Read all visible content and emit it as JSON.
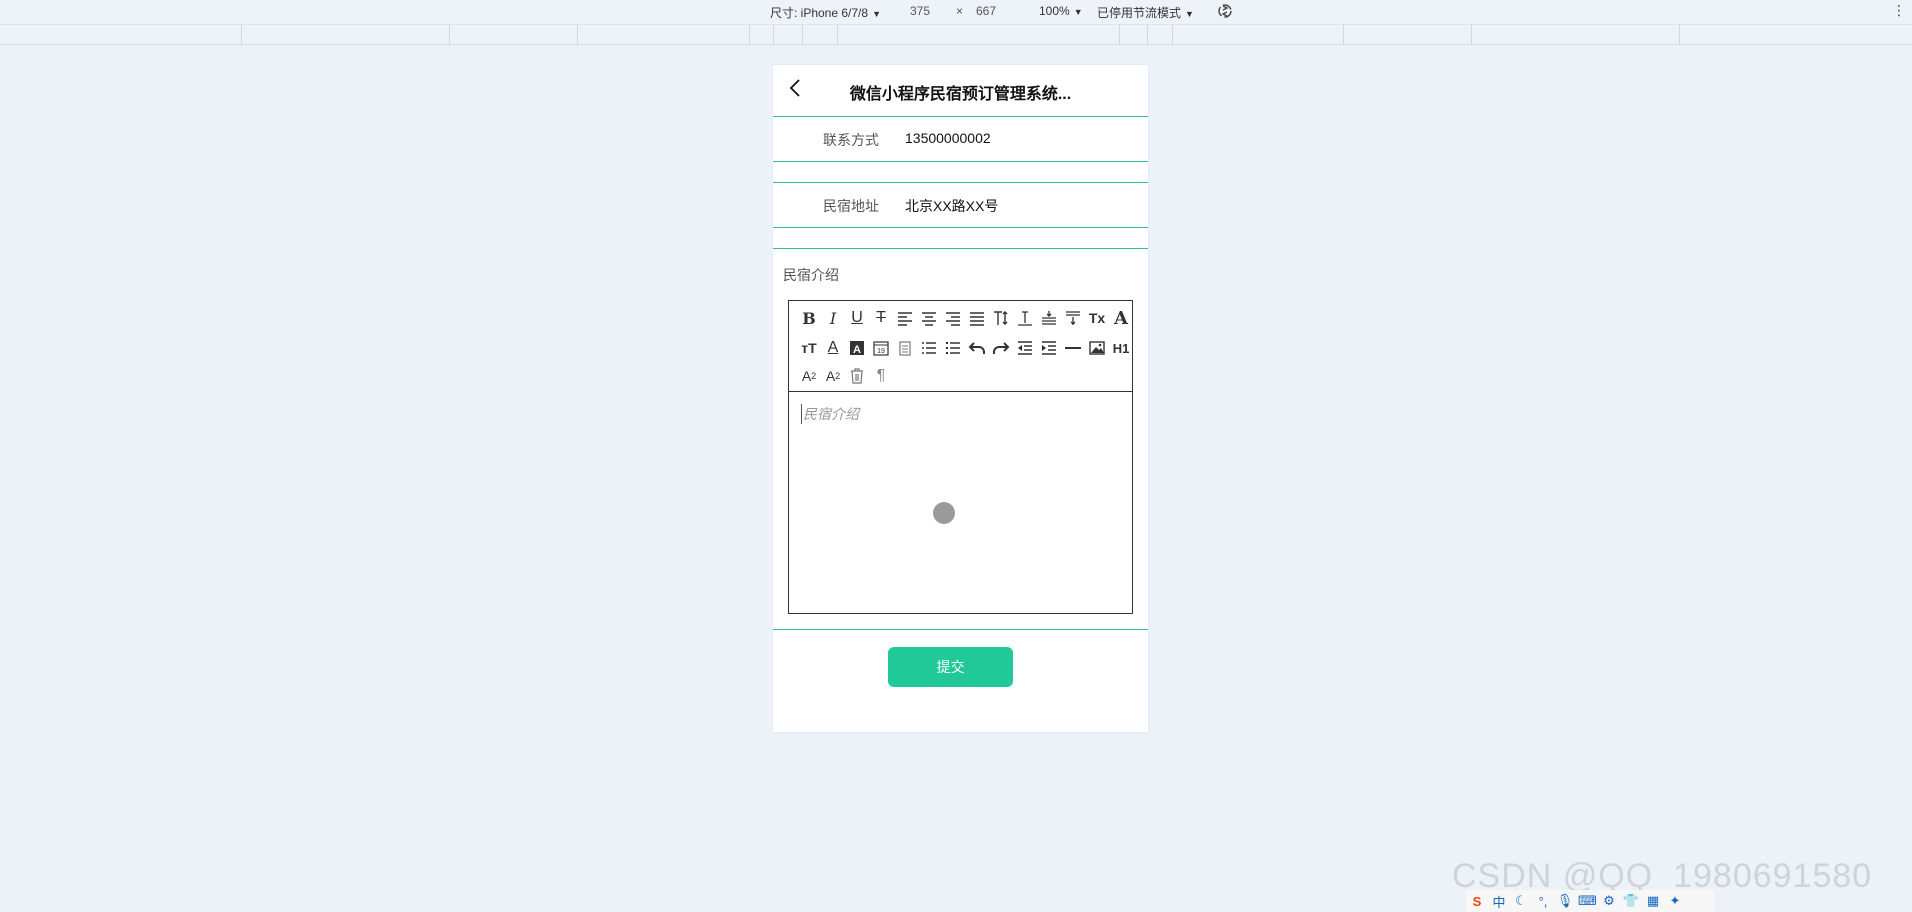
{
  "devtools": {
    "device_label": "尺寸: iPhone 6/7/8",
    "width": "375",
    "times": "×",
    "height": "667",
    "zoom": "100%",
    "throttle": "已停用节流模式"
  },
  "app": {
    "title": "微信小程序民宿预订管理系统..."
  },
  "form": {
    "contact": {
      "label": "联系方式",
      "value": "13500000002"
    },
    "address": {
      "label": "民宿地址",
      "value": "北京XX路XX号"
    },
    "intro": {
      "label": "民宿介绍",
      "placeholder": "民宿介绍"
    },
    "submit_label": "提交"
  },
  "editor_toolbar": {
    "h1_label": "H1"
  },
  "watermark": "CSDN @QQ_1980691580",
  "tray": {
    "ime": "中"
  },
  "colors": {
    "accent": "#20c997",
    "divider": "#2fc09a"
  }
}
